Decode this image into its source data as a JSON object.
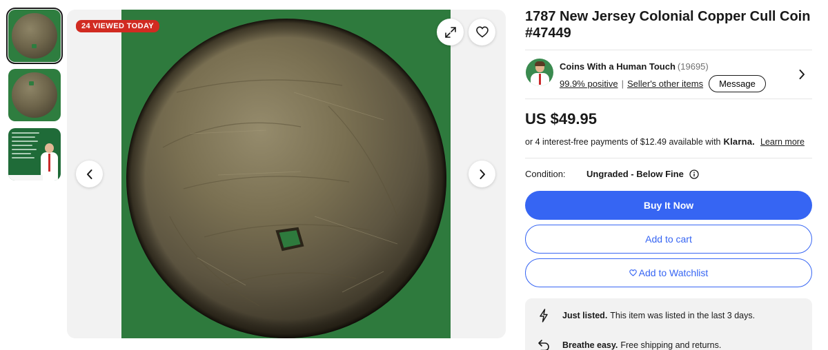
{
  "gallery": {
    "badge": "24 VIEWED TODAY",
    "thumbnails": [
      {
        "name": "coin-front"
      },
      {
        "name": "coin-front-alt"
      },
      {
        "name": "seller-promo-card"
      }
    ],
    "icons": {
      "expand": "expand-icon",
      "watch": "heart-icon",
      "prev": "chevron-left-icon",
      "next": "chevron-right-icon"
    }
  },
  "listing": {
    "title": "1787 New Jersey Colonial Copper Cull Coin #47449",
    "price": "US $49.95"
  },
  "seller": {
    "name": "Coins With a Human Touch",
    "feedback_count": "(19695)",
    "positive": "99.9% positive",
    "other_items": "Seller's other items",
    "message": "Message"
  },
  "klarna": {
    "text": "or 4 interest-free payments of $12.49 available with",
    "brand": "Klarna.",
    "learn_more": "Learn more"
  },
  "condition": {
    "label": "Condition:",
    "value": "Ungraded - Below Fine"
  },
  "actions": {
    "buy_now": "Buy It Now",
    "add_to_cart": "Add to cart",
    "watchlist": "Add to Watchlist"
  },
  "highlights": [
    {
      "icon": "lightning-icon",
      "bold": "Just listed.",
      "text": "This item was listed in the last 3 days."
    },
    {
      "icon": "return-arrow-icon",
      "bold": "Breathe easy.",
      "text": "Free shipping and returns."
    }
  ],
  "colors": {
    "accent": "#3665f3",
    "badge": "#d12b21",
    "background_green": "#2e7a3d"
  }
}
